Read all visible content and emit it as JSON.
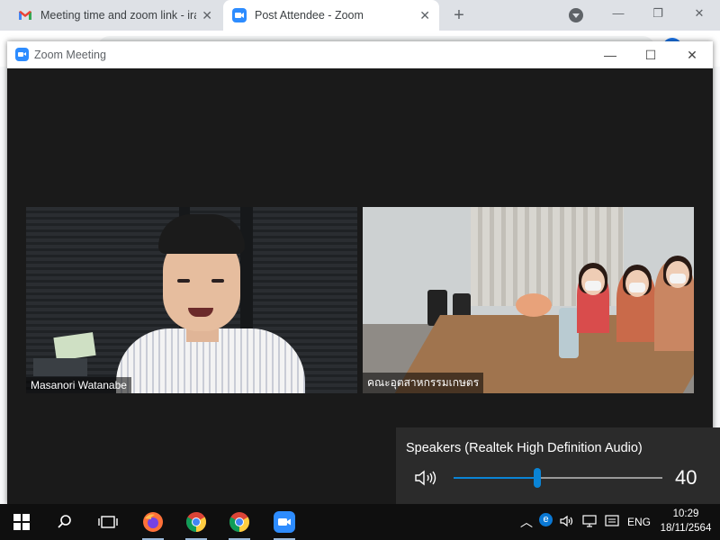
{
  "browser": {
    "tabs": [
      {
        "title": "Meeting time and zoom link - ira",
        "favicon": "gmail-icon"
      },
      {
        "title": "Post Attendee - Zoom",
        "favicon": "zoom-icon"
      }
    ],
    "new_tab_label": "+"
  },
  "zoom_window": {
    "title": "Zoom Meeting",
    "participants": [
      {
        "name": "Masanori Watanabe"
      },
      {
        "name": "คณะอุตสาหกรรมเกษตร"
      }
    ]
  },
  "volume_flyout": {
    "device": "Speakers (Realtek High Definition Audio)",
    "level": 40,
    "accent": "#0a84d6"
  },
  "taskbar": {
    "apps": [
      "start-icon",
      "search-icon",
      "task-view-icon",
      "firefox-icon",
      "chrome-icon",
      "chrome-icon",
      "zoom-icon"
    ],
    "language": "ENG",
    "time": "10:29",
    "date": "18/11/2564"
  }
}
